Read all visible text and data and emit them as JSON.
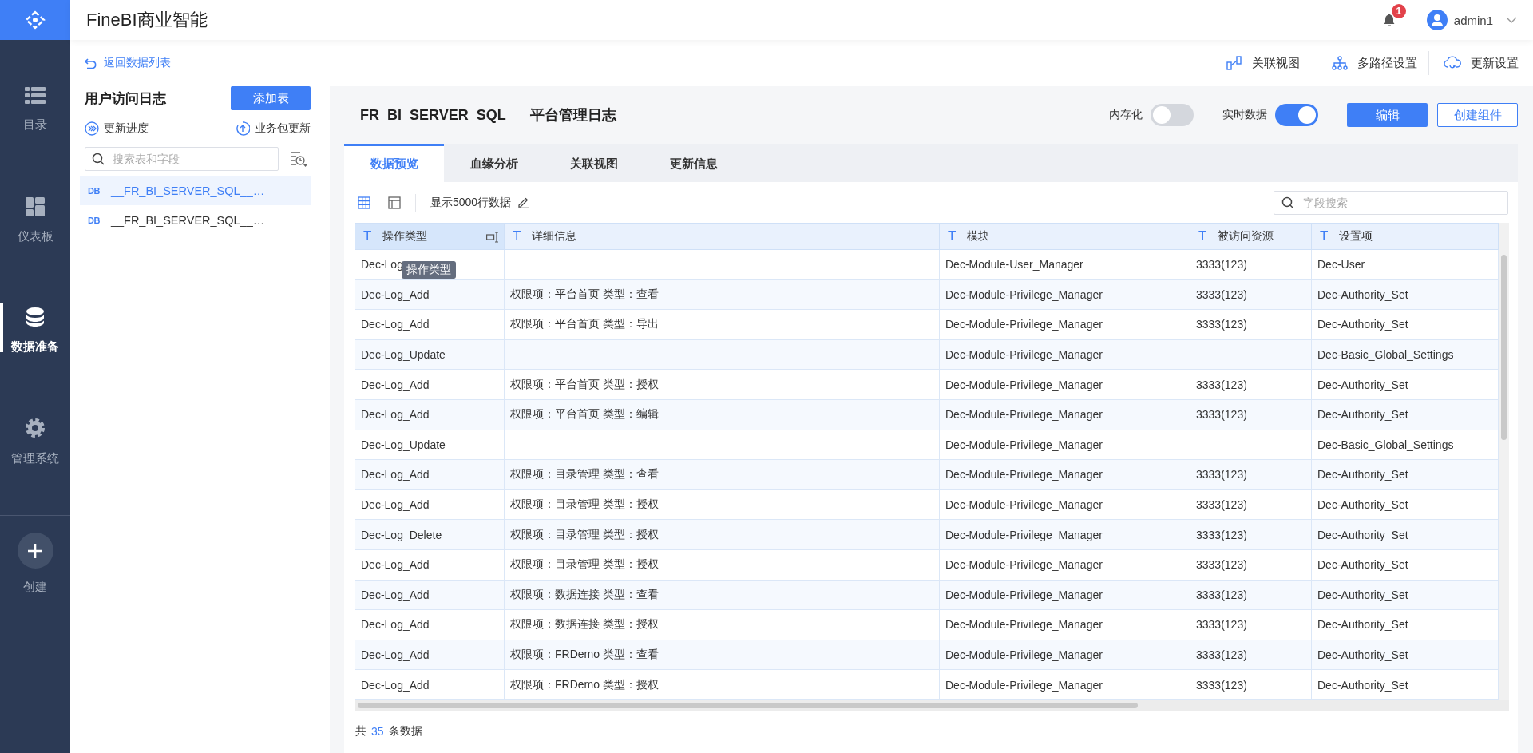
{
  "app": {
    "title": "FineBI商业智能"
  },
  "header": {
    "notification_count": "1",
    "user": "admin1"
  },
  "sidebar": {
    "items": [
      {
        "label": "目录",
        "kind": "list",
        "selected": false
      },
      {
        "label": "仪表板",
        "kind": "dashboard",
        "selected": false
      },
      {
        "label": "数据准备",
        "kind": "database",
        "selected": true
      },
      {
        "label": "管理系统",
        "kind": "gear",
        "selected": false
      }
    ],
    "create": {
      "label": "创建"
    }
  },
  "left_panel": {
    "back_link": "返回数据列表",
    "title": "用户访问日志",
    "add_button": "添加表",
    "actions": [
      {
        "label": "更新进度",
        "kind": "progress"
      },
      {
        "label": "业务包更新",
        "kind": "upload"
      }
    ],
    "search": {
      "placeholder": "搜索表和字段"
    },
    "tables": [
      {
        "badge": "DB",
        "name": "__FR_BI_SERVER_SQL__…",
        "selected": true
      },
      {
        "badge": "DB",
        "name": "__FR_BI_SERVER_SQL__…",
        "selected": false
      }
    ]
  },
  "main": {
    "actions": [
      {
        "label": "关联视图",
        "kind": "relation"
      },
      {
        "label": "多路径设置",
        "kind": "tree"
      },
      {
        "label": "更新设置",
        "kind": "cloud"
      }
    ],
    "title": "__FR_BI_SERVER_SQL___平台管理日志",
    "toggles": [
      {
        "label": "内存化",
        "on": false
      },
      {
        "label": "实时数据",
        "on": true
      }
    ],
    "buttons": [
      {
        "label": "编辑",
        "kind": "primary"
      },
      {
        "label": "创建组件",
        "kind": "outline"
      }
    ],
    "tabs": [
      {
        "label": "数据预览",
        "selected": true
      },
      {
        "label": "血缘分析",
        "selected": false
      },
      {
        "label": "关联视图",
        "selected": false
      },
      {
        "label": "更新信息",
        "selected": false
      }
    ],
    "toolbar": {
      "views": [
        {
          "kind": "grid",
          "selected": true
        },
        {
          "kind": "layout",
          "selected": false
        }
      ],
      "row_limit": "显示5000行数据"
    },
    "field_search": {
      "placeholder": "字段搜索"
    },
    "table": {
      "columns": [
        {
          "type": "T",
          "label": "操作类型",
          "selected": true
        },
        {
          "type": "T",
          "label": "详细信息",
          "selected": false
        },
        {
          "type": "T",
          "label": "模块",
          "selected": false
        },
        {
          "type": "T",
          "label": "被访问资源",
          "selected": false
        },
        {
          "type": "T",
          "label": "设置项",
          "selected": false
        }
      ],
      "rows": [
        [
          "Dec-Log",
          null,
          "Dec-Module-User_Manager",
          "3333(123)",
          "Dec-User"
        ],
        [
          "Dec-Log_Add",
          "权限项：平台首页 类型：查看",
          "Dec-Module-Privilege_Manager",
          "3333(123)",
          "Dec-Authority_Set"
        ],
        [
          "Dec-Log_Add",
          "权限项：平台首页 类型：导出",
          "Dec-Module-Privilege_Manager",
          "3333(123)",
          "Dec-Authority_Set"
        ],
        [
          "Dec-Log_Update",
          null,
          "Dec-Module-Privilege_Manager",
          null,
          "Dec-Basic_Global_Settings"
        ],
        [
          "Dec-Log_Add",
          "权限项：平台首页 类型：授权",
          "Dec-Module-Privilege_Manager",
          "3333(123)",
          "Dec-Authority_Set"
        ],
        [
          "Dec-Log_Add",
          "权限项：平台首页 类型：编辑",
          "Dec-Module-Privilege_Manager",
          "3333(123)",
          "Dec-Authority_Set"
        ],
        [
          "Dec-Log_Update",
          null,
          "Dec-Module-Privilege_Manager",
          null,
          "Dec-Basic_Global_Settings"
        ],
        [
          "Dec-Log_Add",
          "权限项：目录管理 类型：查看",
          "Dec-Module-Privilege_Manager",
          "3333(123)",
          "Dec-Authority_Set"
        ],
        [
          "Dec-Log_Add",
          "权限项：目录管理 类型：授权",
          "Dec-Module-Privilege_Manager",
          "3333(123)",
          "Dec-Authority_Set"
        ],
        [
          "Dec-Log_Delete",
          "权限项：目录管理 类型：授权",
          "Dec-Module-Privilege_Manager",
          "3333(123)",
          "Dec-Authority_Set"
        ],
        [
          "Dec-Log_Add",
          "权限项：目录管理 类型：授权",
          "Dec-Module-Privilege_Manager",
          "3333(123)",
          "Dec-Authority_Set"
        ],
        [
          "Dec-Log_Add",
          "权限项：数据连接 类型：查看",
          "Dec-Module-Privilege_Manager",
          "3333(123)",
          "Dec-Authority_Set"
        ],
        [
          "Dec-Log_Add",
          "权限项：数据连接 类型：授权",
          "Dec-Module-Privilege_Manager",
          "3333(123)",
          "Dec-Authority_Set"
        ],
        [
          "Dec-Log_Add",
          "权限项：FRDemo 类型：查看",
          "Dec-Module-Privilege_Manager",
          "3333(123)",
          "Dec-Authority_Set"
        ],
        [
          "Dec-Log_Add",
          "权限项：FRDemo 类型：授权",
          "Dec-Module-Privilege_Manager",
          "3333(123)",
          "Dec-Authority_Set"
        ]
      ]
    },
    "tooltip": "操作类型",
    "footer": {
      "prefix": "共",
      "count": "35",
      "suffix": "条数据"
    }
  }
}
